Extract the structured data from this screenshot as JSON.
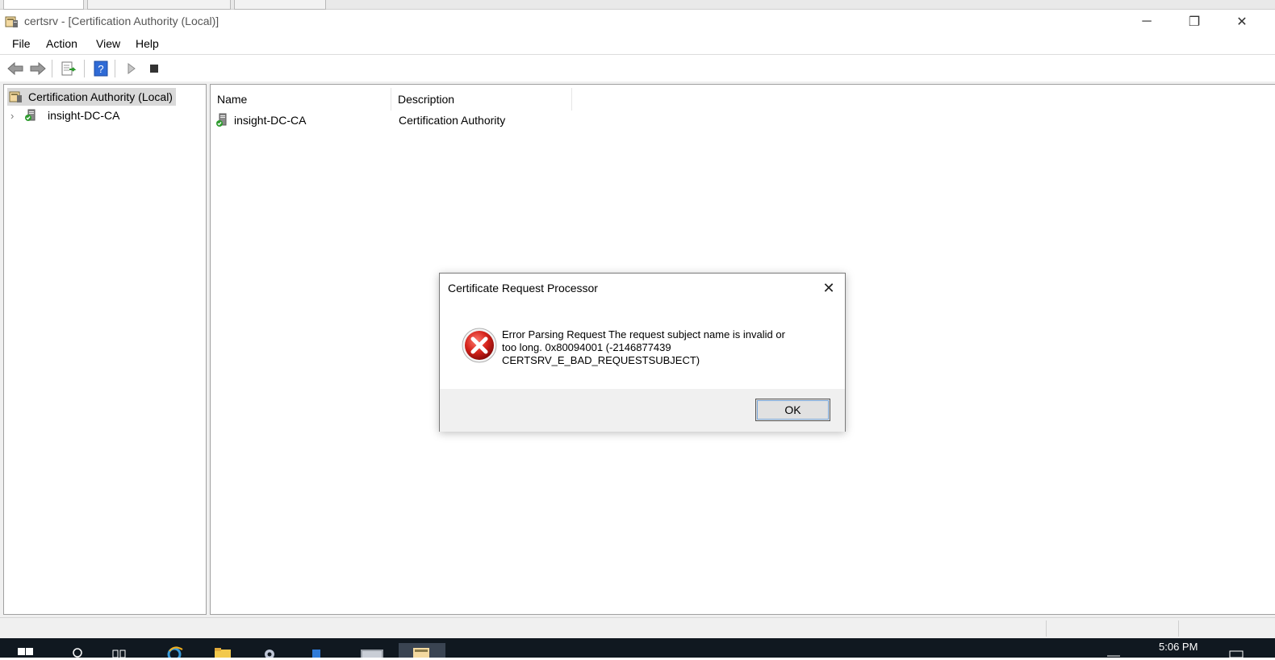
{
  "window": {
    "title": "certsrv - [Certification Authority (Local)]",
    "controls": {
      "minimize": "─",
      "restore": "❐",
      "close": "✕"
    }
  },
  "menubar": {
    "items": [
      "File",
      "Action",
      "View",
      "Help"
    ]
  },
  "toolbar": {
    "icons": [
      "back-arrow-icon",
      "forward-arrow-icon",
      "export-list-icon",
      "help-icon",
      "start-service-icon",
      "stop-service-icon"
    ]
  },
  "tree": {
    "root": "Certification Authority (Local)",
    "children": [
      {
        "label": "insight-DC-CA",
        "expander": "›"
      }
    ]
  },
  "list": {
    "columns": [
      "Name",
      "Description"
    ],
    "rows": [
      {
        "name": "insight-DC-CA",
        "description": "Certification Authority"
      }
    ]
  },
  "dialog": {
    "title": "Certificate Request Processor",
    "message_lines": [
      "Error Parsing Request  The request subject name is invalid or",
      "too long. 0x80094001 (-2146877439",
      "CERTSRV_E_BAD_REQUESTSUBJECT)"
    ],
    "ok_label": "OK",
    "close_glyph": "✕"
  },
  "taskbar": {
    "clock": "5:06 PM"
  },
  "colors": {
    "accent": "#0078d7",
    "error_red": "#c4161c",
    "taskbar": "#101820"
  }
}
